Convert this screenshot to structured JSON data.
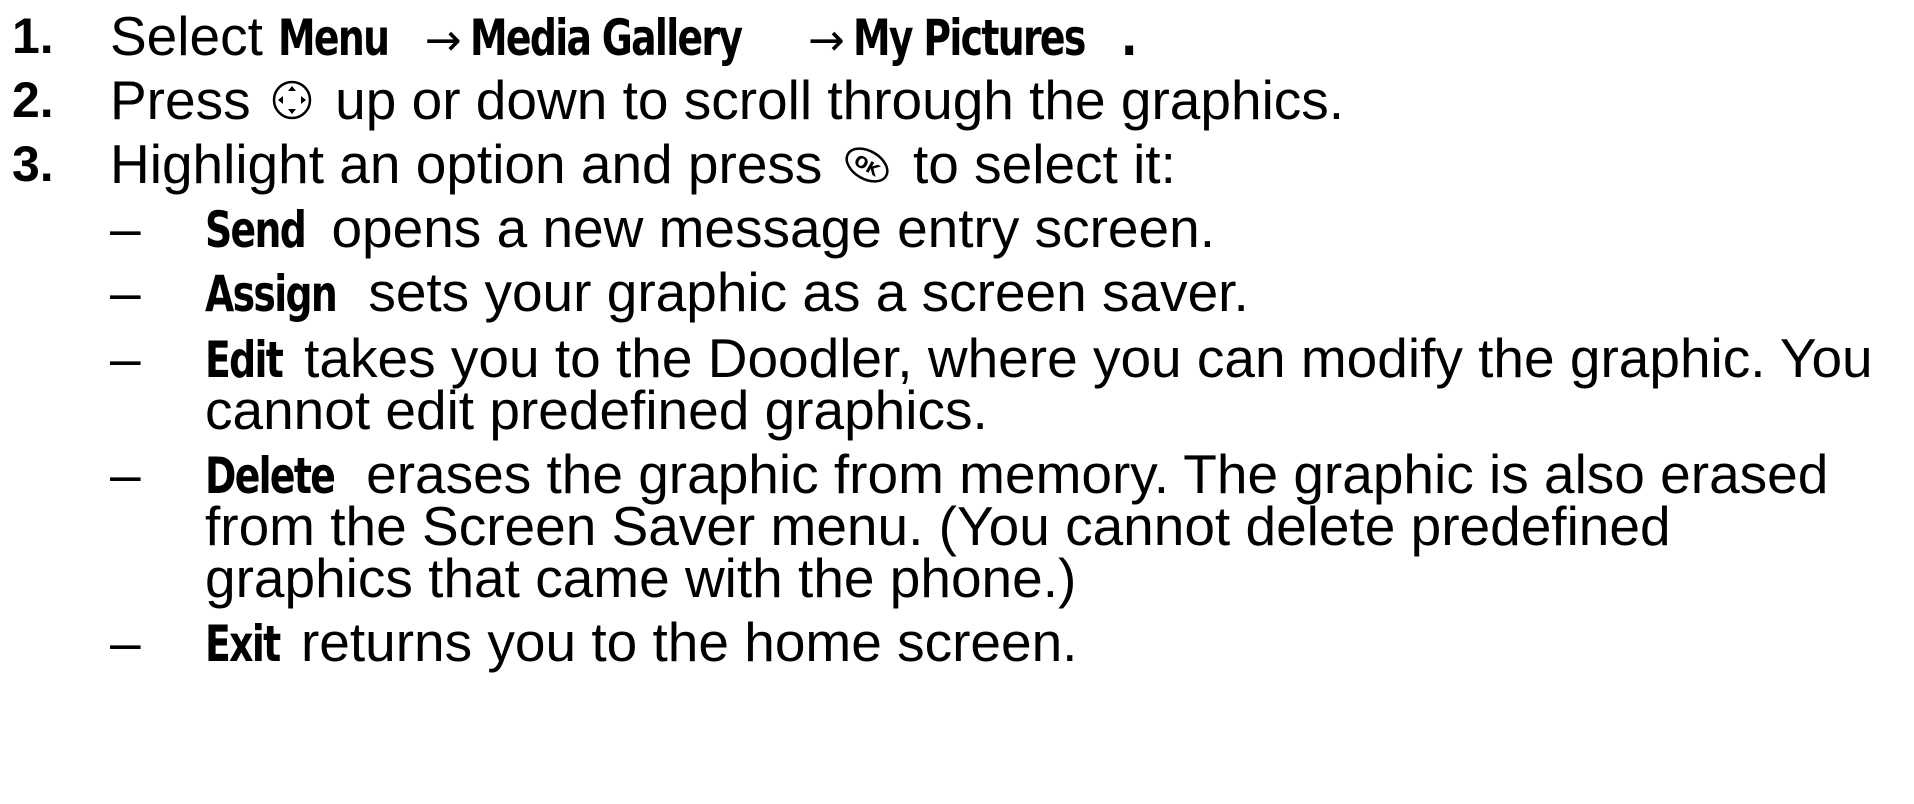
{
  "steps": [
    {
      "number": "1.",
      "text_select": "Select",
      "menu": "Menu",
      "arrow1": "→",
      "media_gallery": "Media Gallery",
      "arrow2": "→",
      "my_pictures": "My Pictures",
      "end": "."
    },
    {
      "number": "2.",
      "text_before": "Press",
      "icon": "navigation-key-icon",
      "text_after": "up or down to scroll through the graphics."
    },
    {
      "number": "3.",
      "text_before": "Highlight an option and press",
      "icon": "ok-key-icon",
      "text_after": "to select it:"
    }
  ],
  "options": [
    {
      "dash": "–",
      "keyword": "Send",
      "lines": [
        "opens a new message entry screen."
      ]
    },
    {
      "dash": "–",
      "keyword": "Assign",
      "lines": [
        "sets your graphic as a screen saver."
      ]
    },
    {
      "dash": "–",
      "keyword": "Edit",
      "lines": [
        "takes you to the Doodler, where you can modify the graphic. You",
        "cannot edit predefined graphics."
      ]
    },
    {
      "dash": "–",
      "keyword": "Delete",
      "lines": [
        "erases the graphic from memory. The graphic is also erased",
        "from the Screen Saver menu. (You cannot delete predefined",
        "graphics that came with the phone.)"
      ]
    },
    {
      "dash": "–",
      "keyword": "Exit",
      "lines": [
        "returns you to the home screen."
      ]
    }
  ]
}
